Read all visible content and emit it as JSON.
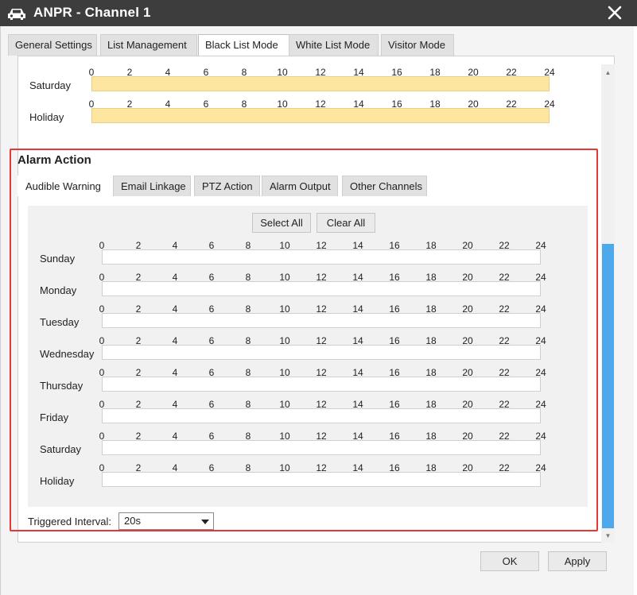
{
  "window": {
    "title": "ANPR - Channel 1",
    "icon": "car-icon",
    "close_icon": "close-icon"
  },
  "tabs": [
    {
      "label": "General Settings",
      "active": false
    },
    {
      "label": "List Management",
      "active": false
    },
    {
      "label": "Black List Mode",
      "active": true
    },
    {
      "label": "White List Mode",
      "active": false
    },
    {
      "label": "Visitor Mode",
      "active": false
    }
  ],
  "hours": [
    "0",
    "2",
    "4",
    "6",
    "8",
    "10",
    "12",
    "14",
    "16",
    "18",
    "20",
    "22",
    "24"
  ],
  "top_schedule": [
    {
      "day": "Saturday",
      "filled": true
    },
    {
      "day": "Holiday",
      "filled": true
    }
  ],
  "alarm_action": {
    "title": "Alarm Action",
    "subtabs": [
      {
        "label": "Audible Warning",
        "active": true
      },
      {
        "label": "Email Linkage",
        "active": false
      },
      {
        "label": "PTZ Action",
        "active": false
      },
      {
        "label": "Alarm Output",
        "active": false
      },
      {
        "label": "Other Channels",
        "active": false
      }
    ],
    "select_all_label": "Select All",
    "clear_all_label": "Clear All",
    "days": [
      "Sunday",
      "Monday",
      "Tuesday",
      "Wednesday",
      "Thursday",
      "Friday",
      "Saturday",
      "Holiday"
    ],
    "interval_label": "Triggered Interval:",
    "interval_value": "20s"
  },
  "footer": {
    "ok_label": "OK",
    "apply_label": "Apply"
  },
  "colors": {
    "titlebar": "#3d3d3d",
    "highlight_border": "#e53935",
    "schedule_fill": "#fce6a0",
    "scrollbar_thumb": "#4ea8ec"
  }
}
